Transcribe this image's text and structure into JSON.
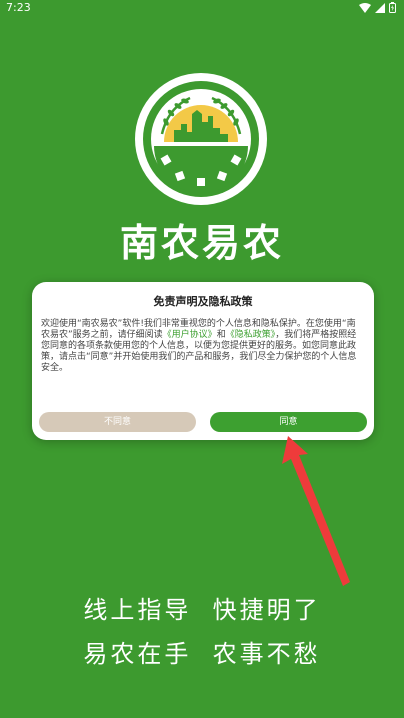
{
  "status_bar": {
    "time": "7:23"
  },
  "app": {
    "title": "南农易农"
  },
  "dialog": {
    "title": "免责声明及隐私政策",
    "body_before_link1": "欢迎使用“南农易农”软件!我们非常重视您的个人信息和隐私保护。在您使用“南农易农”服务之前，请仔细阅读",
    "link_user_agreement": "《用户协议》",
    "body_between_links": "和",
    "link_privacy_policy": "《隐私政策》",
    "body_after_link2": "，我们将严格按照经您同意的各项条款使用您的个人信息，以便为您提供更好的服务。如您同意此政策，请点击“同意”并开始使用我们的产品和服务，我们尽全力保护您的个人信息安全。",
    "disagree_label": "不同意",
    "agree_label": "同意"
  },
  "slogans": {
    "line1": "线上指导  快捷明了",
    "line2": "易农在手  农事不愁"
  },
  "colors": {
    "background": "#3d9a2f",
    "accent": "#3da030",
    "disagree": "#d6c9b8",
    "arrow": "#ee3b3b"
  }
}
